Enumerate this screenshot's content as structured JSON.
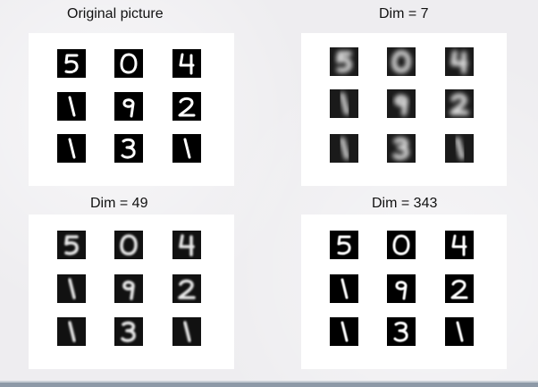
{
  "panels": [
    {
      "id": "original",
      "caption": "Original picture",
      "digits": [
        [
          "5",
          "0",
          "4"
        ],
        [
          "1",
          "9",
          "2"
        ],
        [
          "1",
          "3",
          "1"
        ]
      ],
      "quality": "crisp"
    },
    {
      "id": "dim7",
      "caption": "Dim = 7",
      "digits": [
        [
          "5",
          "0",
          "4"
        ],
        [
          "1",
          "9",
          "2"
        ],
        [
          "1",
          "3",
          "1"
        ]
      ],
      "quality": "very-blurry"
    },
    {
      "id": "dim49",
      "caption": "Dim = 49",
      "digits": [
        [
          "5",
          "0",
          "4"
        ],
        [
          "1",
          "9",
          "2"
        ],
        [
          "1",
          "3",
          "1"
        ]
      ],
      "quality": "slightly-blurry"
    },
    {
      "id": "dim343",
      "caption": "Dim = 343",
      "digits": [
        [
          "5",
          "0",
          "4"
        ],
        [
          "1",
          "9",
          "2"
        ],
        [
          "1",
          "3",
          "1"
        ]
      ],
      "quality": "sharp"
    }
  ],
  "colors": {
    "background": "#eeedf0",
    "panel": "#ffffff",
    "cell": "#000000",
    "stroke": "#ffffff",
    "bottom_bar": "#8d99a7"
  }
}
